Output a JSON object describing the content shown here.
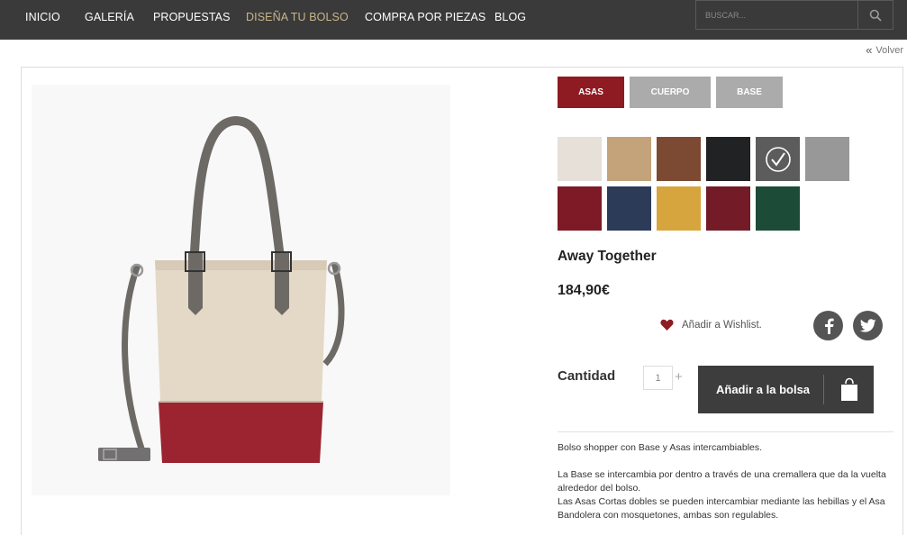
{
  "nav": {
    "items": [
      {
        "label": "INICIO"
      },
      {
        "label": "GALERÍA"
      },
      {
        "label": "PROPUESTAS"
      },
      {
        "label": "DISEÑA TU BOLSO"
      },
      {
        "label": "COMPRA POR PIEZAS"
      },
      {
        "label": "BLOG"
      }
    ],
    "active_color": "#c8b58a",
    "search_placeholder": "BUSCAR...",
    "search_icon": "search-icon"
  },
  "back_link": "Volver",
  "tabs": [
    {
      "label": "ASAS",
      "active": true,
      "color": "#8e1b22"
    },
    {
      "label": "CUERPO",
      "active": false,
      "color": "#ababab"
    },
    {
      "label": "BASE",
      "active": false,
      "color": "#ababab"
    }
  ],
  "swatches": [
    {
      "color": "#e6e0d8",
      "selected": false
    },
    {
      "color": "#c4a27a",
      "selected": false
    },
    {
      "color": "#7c4a32",
      "selected": false
    },
    {
      "color": "#202224",
      "selected": false
    },
    {
      "color": "#5c5c5c",
      "selected": true
    },
    {
      "color": "#989898",
      "selected": false
    },
    {
      "color": "#7d1a26",
      "selected": false
    },
    {
      "color": "#2c3c58",
      "selected": false
    },
    {
      "color": "#d7a53e",
      "selected": false
    },
    {
      "color": "#731c28",
      "selected": false
    },
    {
      "color": "#1c4c38",
      "selected": false
    }
  ],
  "product": {
    "name": "Away Together",
    "price": "184,90€",
    "wishlist_label": "Añadir a Wishlist.",
    "quantity_label": "Cantidad",
    "quantity_value": "1",
    "add_to_bag_label": "Añadir a la bolsa",
    "description": {
      "line1": "Bolso shopper con Base y Asas intercambiables.",
      "para2": "La Base se intercambia por dentro a través de una cremallera que da la vuelta alrededor del bolso.",
      "para3": "Las Asas Cortas dobles se pueden intercambiar mediante las hebillas y el Asa Bandolera con mosquetones, ambas son regulables."
    }
  },
  "social": [
    "facebook-icon",
    "twitter-icon"
  ]
}
